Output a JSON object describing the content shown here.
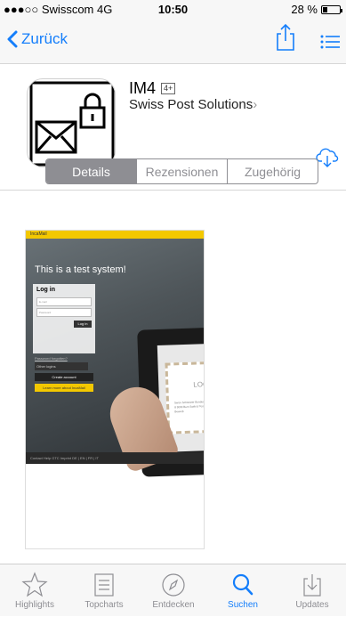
{
  "status": {
    "carrier": "●●●○○ Swisscom 4G",
    "time": "10:50",
    "battery": "28 %"
  },
  "nav": {
    "back_label": "Zurück"
  },
  "app": {
    "name": "IM4",
    "age_rating": "4+",
    "developer": "Swiss Post Solutions",
    "developer_chevron": "›"
  },
  "segments": [
    {
      "label": "Details",
      "active": true
    },
    {
      "label": "Rezensionen",
      "active": false
    },
    {
      "label": "Zugehörig",
      "active": false
    }
  ],
  "screenshot": {
    "brand": "IncaMail",
    "tagline": "This is a test system!",
    "login_title": "Log in",
    "email_placeholder": "E-mail",
    "password_placeholder": "Password",
    "login_button": "Log in",
    "forgot": "Password forgotten?",
    "other_login": "Other logins",
    "create_account": "Create account",
    "learn_more": "Learn more about IncaMail",
    "envelope_logo": "LOGO",
    "envelope_text": "Swiss Schweizer Bundesstrasse 8 3030 Bern Swift & Postal Bewerb",
    "footer": "Contact  Help  GTC  Imprint  DE | EN | FR | IT"
  },
  "tabbar": [
    {
      "label": "Highlights",
      "icon": "star-icon",
      "active": false
    },
    {
      "label": "Topcharts",
      "icon": "list-icon",
      "active": false
    },
    {
      "label": "Entdecken",
      "icon": "compass-icon",
      "active": false
    },
    {
      "label": "Suchen",
      "icon": "search-icon",
      "active": true
    },
    {
      "label": "Updates",
      "icon": "download-icon",
      "active": false
    }
  ],
  "colors": {
    "accent": "#147efb",
    "inactive": "#8e8e93",
    "brand_yellow": "#f3c800"
  }
}
